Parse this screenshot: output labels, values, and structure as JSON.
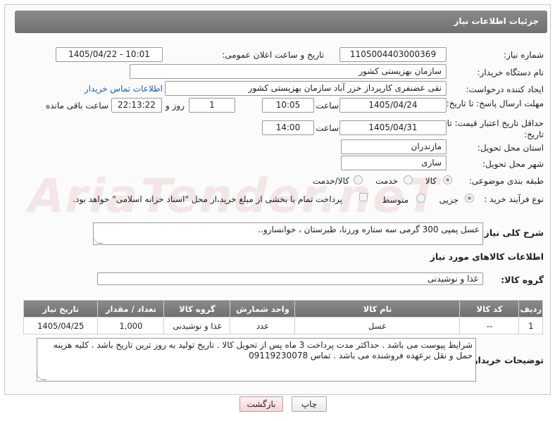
{
  "header": {
    "title": "جزئیات اطلاعات نیاز"
  },
  "form": {
    "need_number_label": "شماره نیاز:",
    "need_number": "1105004403000369",
    "announce_label": "تاریخ و ساعت اعلان عمومی:",
    "announce_value": "1405/04/22 - 10:01",
    "buyer_org_label": "نام دستگاه خریدار:",
    "buyer_org": "سازمان بهزیستی کشور",
    "creator_label": "ایجاد کننده درخواست:",
    "creator": "نقی عضنفری کارپرداز خزر آباد سازمان بهزیستی کشور",
    "contact_link": "اطلاعات تماس خریدار",
    "deadline_label": "مهلت ارسال پاسخ: تا تاریخ:",
    "deadline_date": "1405/04/24",
    "time_label": "ساعت",
    "deadline_time": "10:05",
    "days_value": "1",
    "days_label": "روز و",
    "remaining_time": "22:13:22",
    "remaining_label": "ساعت باقی مانده",
    "price_valid_label": "حداقل تاریخ اعتبار قیمت: تا تاریخ:",
    "price_valid_date": "1405/04/31",
    "price_valid_time": "14:00",
    "province_label": "استان محل تحویل:",
    "province": "مازندران",
    "city_label": "شهر محل تحویل:",
    "city": "ساری",
    "category_label": "طبقه بندی موضوعی:",
    "category_options": [
      "کالا",
      "خدمت",
      "کالا/خدمت"
    ],
    "process_label": "نوع فرآیند خرید :",
    "process_options": [
      "جزیی",
      "متوسط"
    ],
    "payment_note": "پرداخت تمام یا بخشی از مبلغ خرید،از محل \"اسناد خزانه اسلامی\" خواهد بود.",
    "description_label": "شرح کلی نیاز:",
    "description": "عسل پمپی 300 گرمی سه ستاره ورزنا، طبرستان ، خوانسارو..",
    "goods_info_title": "اطلاعات کالاهای مورد نیاز",
    "goods_group_label": "گروه کالا:",
    "goods_group": "غذا و نوشیدنی",
    "buyer_notes_label": "توضیحات خریدار:",
    "buyer_notes": "شرایط پیوست می باشد . حداکثر مدت پرداخت 3 ماه پس از تحویل کالا . تاریخ تولید به روز ترین تاریخ باشد . کلیه هزینه حمل و نقل برعهده فروشنده می باشد . تماس 09119230078"
  },
  "table": {
    "headers": [
      "ردیف",
      "کد کالا",
      "نام کالا",
      "واحد شمارش",
      "گروه کالا",
      "تعداد / مقدار",
      "تاریخ نیاز"
    ],
    "rows": [
      [
        "1",
        "--",
        "عسل",
        "عدد",
        "غذا و نوشیدنی",
        "1,000",
        "1405/04/25"
      ]
    ]
  },
  "buttons": {
    "print": "چاپ",
    "back": "بازگشت"
  },
  "watermark": "AriaTender.neT"
}
